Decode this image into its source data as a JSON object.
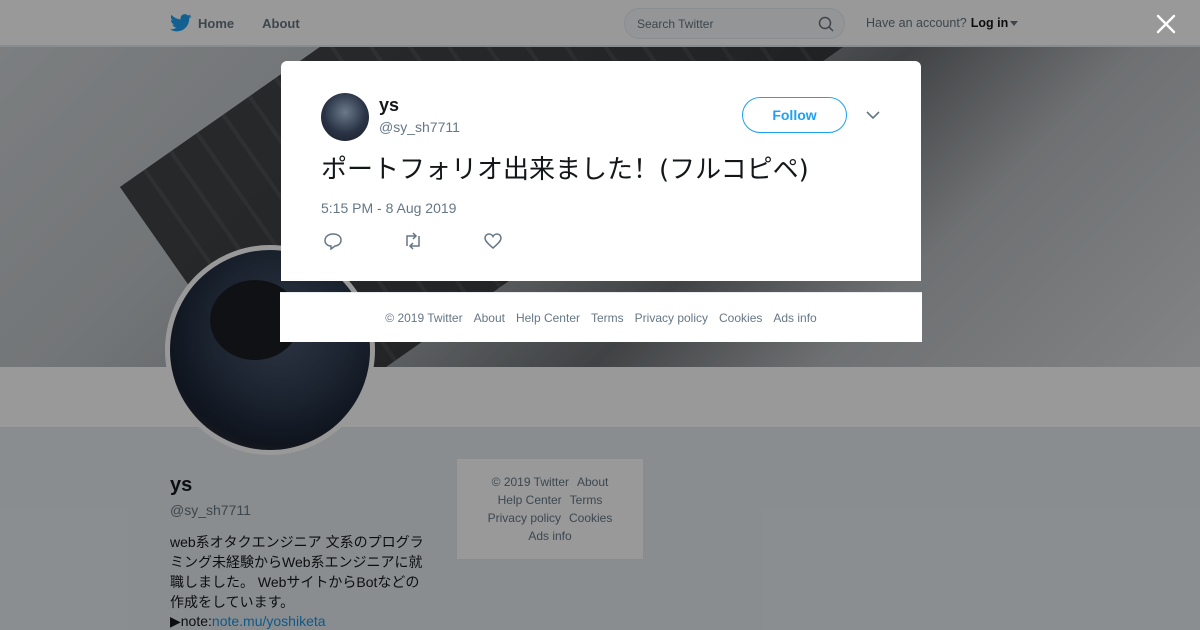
{
  "nav": {
    "home_label": "Home",
    "about_label": "About",
    "search_placeholder": "Search Twitter",
    "account_prompt": "Have an account?",
    "login_label": "Log in",
    "brand_color": "#1da1f2"
  },
  "profile": {
    "name": "ys",
    "handle": "@sy_sh7711",
    "bio": "web系オタクエンジニア 文系のプログラミング未経験からWeb系エンジニアに就職しました。 WebサイトからBotなどの作成をしています。",
    "link_prefix": "▶note:",
    "link_text": "note.mu/yoshiketa"
  },
  "side_footer": {
    "items": [
      "© 2019 Twitter",
      "About",
      "Help Center",
      "Terms",
      "Privacy policy",
      "Cookies",
      "Ads info"
    ]
  },
  "tweet": {
    "name": "ys",
    "handle": "@sy_sh7711",
    "follow_label": "Follow",
    "text": "ポートフォリオ出来ました！(フルコピペ)",
    "timestamp": "5:15 PM - 8 Aug 2019"
  },
  "modal_footer": {
    "items": [
      "© 2019 Twitter",
      "About",
      "Help Center",
      "Terms",
      "Privacy policy",
      "Cookies",
      "Ads info"
    ]
  }
}
